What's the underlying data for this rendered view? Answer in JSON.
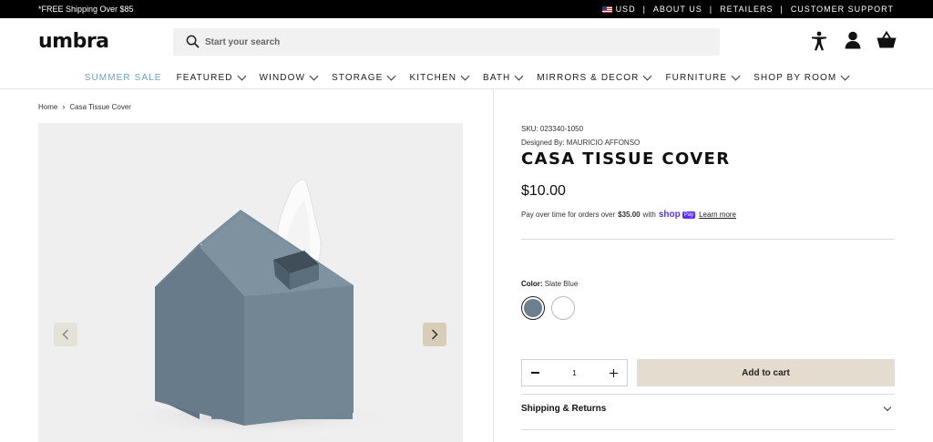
{
  "topbar": {
    "promo": "*FREE Shipping Over $85",
    "currency": "USD",
    "links": [
      "ABOUT US",
      "RETAILERS",
      "CUSTOMER SUPPORT"
    ]
  },
  "header": {
    "logo": "umbra",
    "search_placeholder": "Start your search",
    "icons": [
      "accessibility-icon",
      "account-icon",
      "cart-icon"
    ]
  },
  "nav": {
    "items": [
      "SUMMER SALE",
      "FEATURED",
      "WINDOW",
      "STORAGE",
      "KITCHEN",
      "BATH",
      "MIRRORS & DECOR",
      "FURNITURE",
      "SHOP BY ROOM"
    ]
  },
  "breadcrumb": [
    "Home",
    "Casa Tissue Cover"
  ],
  "product": {
    "sku": "SKU: 023340-1050",
    "designer": "Designed By: MAURICIO AFFONSO",
    "title": "CASA TISSUE COVER",
    "price": "$10.00",
    "pay_text": "Pay over time for orders over",
    "pay_amount": "$35.00",
    "pay_with": "with",
    "shop_label": "shop",
    "pay_badge": "Pay",
    "learn_more": "Learn more",
    "color_label": "Color:",
    "color_value": "Slate Blue",
    "quantity": "1",
    "add_to_cart": "Add to cart",
    "shipping_returns": "Shipping & Returns"
  },
  "colors": {
    "sale": "#6aa3c9",
    "slate_blue": "#6b7f8e",
    "add_to_cart_bg": "#e4dcce",
    "shop_pay": "#5a31f4"
  }
}
